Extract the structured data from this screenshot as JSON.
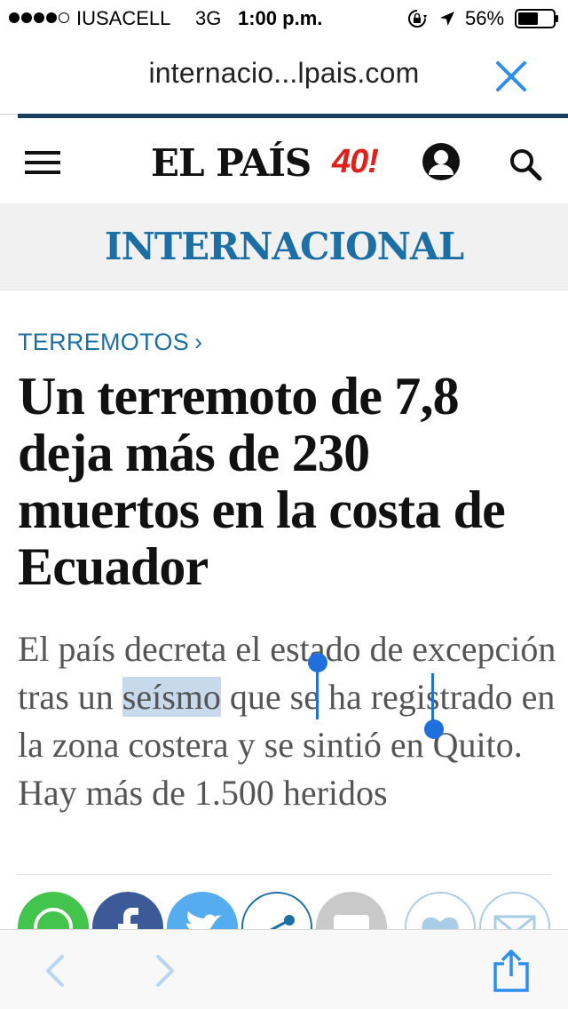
{
  "status_bar": {
    "carrier": "IUSACELL",
    "network": "3G",
    "time": "1:00 p.m.",
    "battery": "56%",
    "battery_level": 0.56,
    "signal_bars_filled": 4,
    "signal_bars_total": 5
  },
  "url_bar": {
    "url": "internacio...lpais.com",
    "close_icon": "close-icon"
  },
  "header": {
    "logo": "EL PAÍS",
    "anniversary_badge": "40!",
    "menu_icon": "menu-icon",
    "user_icon": "user-icon",
    "search_icon": "search-icon"
  },
  "section": {
    "title": "INTERNACIONAL"
  },
  "article": {
    "kicker": "TERREMOTOS",
    "kicker_chevron": "›",
    "headline": "Un terremoto de 7,8 deja más de 230 muertos en la costa de Ecuador",
    "summary_before": "El país decreta el estado de excepción tras un ",
    "summary_selected": "seísmo",
    "summary_after": " que se ha registrado en la zona costera y se sintió en Quito. Hay más de 1.500 heridos"
  },
  "share": {
    "buttons": [
      "whatsapp-icon",
      "facebook-icon",
      "twitter-icon",
      "share-network-icon",
      "comment-icon",
      "like-icon",
      "mail-icon"
    ]
  },
  "toolbar": {
    "back_icon": "chevron-left-icon",
    "forward_icon": "chevron-right-icon",
    "share_icon": "share-icon"
  },
  "colors": {
    "accent_blue": "#1b6fa5",
    "badge_red": "#e0201b",
    "selection_blue": "#1f6fdc",
    "selection_fill": "#c8d9ec",
    "ios_blue": "#2d8ef0"
  }
}
